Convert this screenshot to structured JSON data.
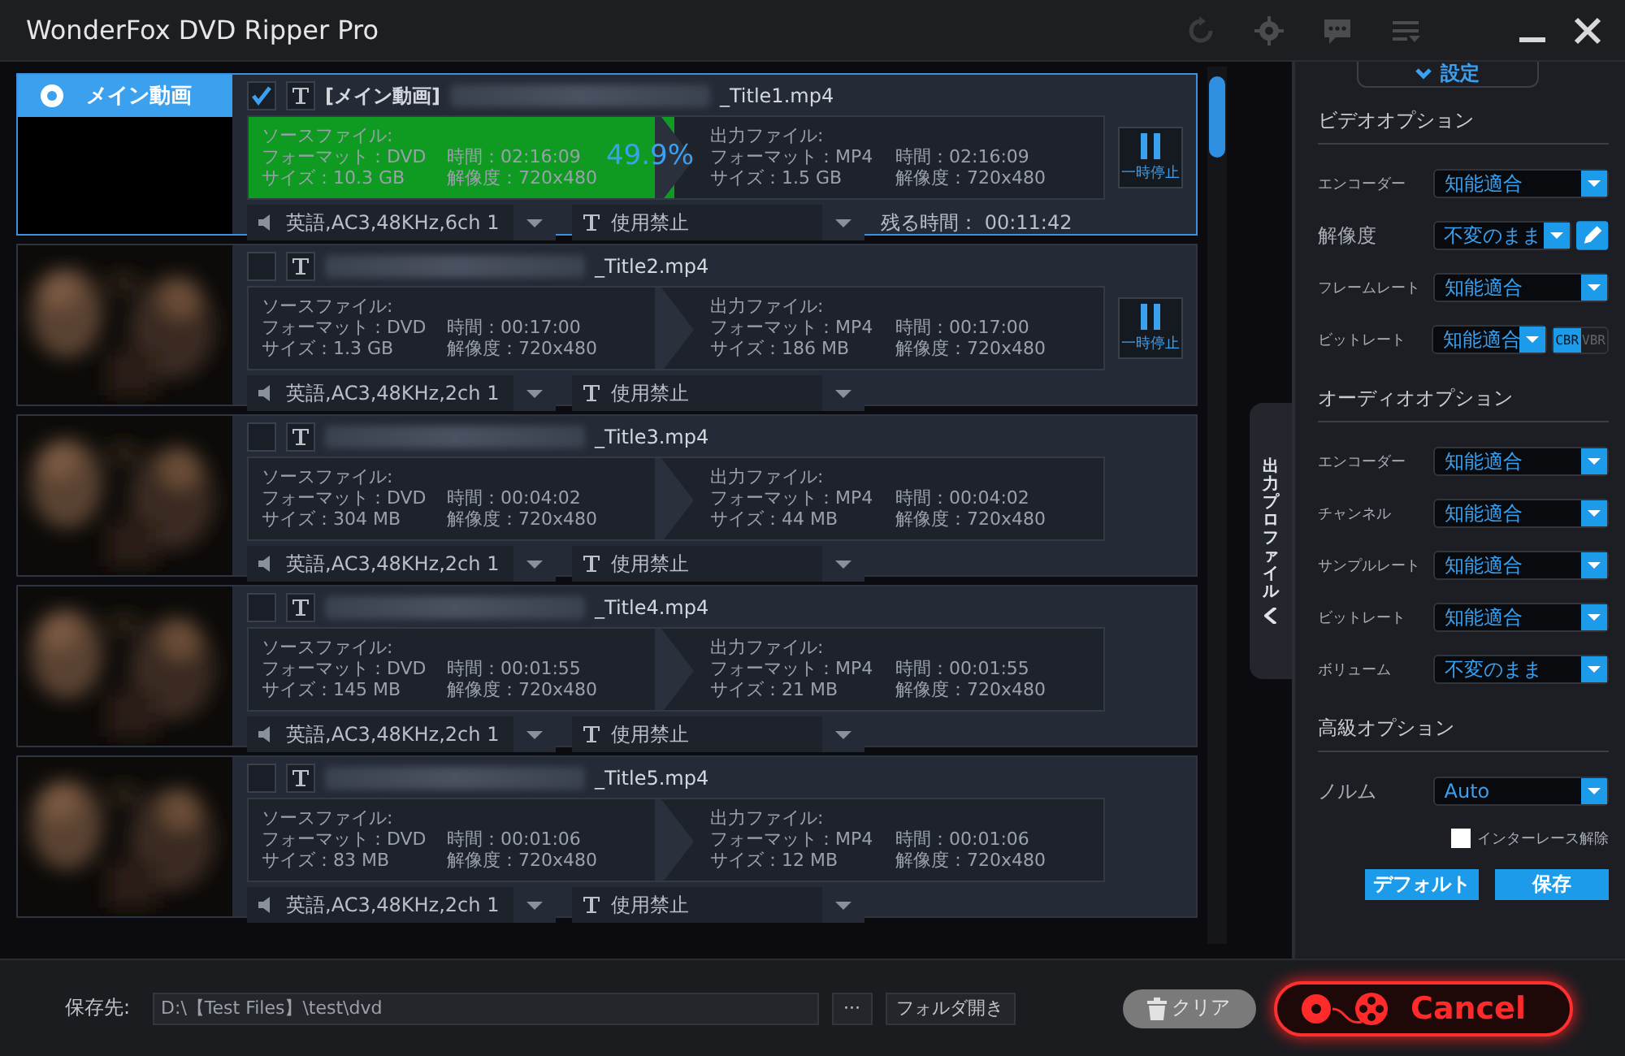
{
  "window": {
    "title": "WonderFox DVD Ripper Pro"
  },
  "titles": [
    {
      "thumbnail": {
        "kind": "main",
        "label": "メイン動画",
        "selected": true
      },
      "checked": true,
      "name_prefix": "[メイン動画]",
      "name_suffix": "_Title1.mp4",
      "source": {
        "label": "ソースファイル:",
        "format": "フォーマット：DVD",
        "duration": "時間：02:16:09",
        "size": "サイズ：10.3 GB",
        "resolution": "解像度：720x480"
      },
      "progress": {
        "level": 0.499,
        "percent": "49.9%"
      },
      "output": {
        "label": "出力ファイル:",
        "format": "フォーマット：MP4",
        "duration": "時間：02:16:09",
        "size": "サイズ：1.5 GB",
        "resolution": "解像度：720x480"
      },
      "pause": "一時停止",
      "audio": "英語,AC3,48KHz,6ch 1",
      "subtitle": "使用禁止",
      "remaining": "残る時間：  00:11:42",
      "active": true
    },
    {
      "checked": false,
      "name_suffix": "_Title2.mp4",
      "source": {
        "label": "ソースファイル:",
        "format": "フォーマット：DVD",
        "duration": "時間：00:17:00",
        "size": "サイズ：1.3 GB",
        "resolution": "解像度：720x480"
      },
      "output": {
        "label": "出力ファイル:",
        "format": "フォーマット：MP4",
        "duration": "時間：00:17:00",
        "size": "サイズ：186 MB",
        "resolution": "解像度：720x480"
      },
      "pause": "一時停止",
      "audio": "英語,AC3,48KHz,2ch 1",
      "subtitle": "使用禁止",
      "active": false
    },
    {
      "checked": false,
      "name_suffix": "_Title3.mp4",
      "source": {
        "label": "ソースファイル:",
        "format": "フォーマット：DVD",
        "duration": "時間：00:04:02",
        "size": "サイズ：304 MB",
        "resolution": "解像度：720x480"
      },
      "output": {
        "label": "出力ファイル:",
        "format": "フォーマット：MP4",
        "duration": "時間：00:04:02",
        "size": "サイズ：44 MB",
        "resolution": "解像度：720x480"
      },
      "audio": "英語,AC3,48KHz,2ch 1",
      "subtitle": "使用禁止",
      "active": false
    },
    {
      "checked": false,
      "name_suffix": "_Title4.mp4",
      "source": {
        "label": "ソースファイル:",
        "format": "フォーマット：DVD",
        "duration": "時間：00:01:55",
        "size": "サイズ：145 MB",
        "resolution": "解像度：720x480"
      },
      "output": {
        "label": "出力ファイル:",
        "format": "フォーマット：MP4",
        "duration": "時間：00:01:55",
        "size": "サイズ：21 MB",
        "resolution": "解像度：720x480"
      },
      "audio": "英語,AC3,48KHz,2ch 1",
      "subtitle": "使用禁止",
      "active": false
    },
    {
      "checked": false,
      "name_suffix": "_Title5.mp4",
      "source": {
        "label": "ソースファイル:",
        "format": "フォーマット：DVD",
        "duration": "時間：00:01:06",
        "size": "サイズ：83 MB",
        "resolution": "解像度：720x480"
      },
      "output": {
        "label": "出力ファイル:",
        "format": "フォーマット：MP4",
        "duration": "時間：00:01:06",
        "size": "サイズ：12 MB",
        "resolution": "解像度：720x480"
      },
      "audio": "英語,AC3,48KHz,2ch 1",
      "subtitle": "使用禁止",
      "active": false
    }
  ],
  "side_tab": {
    "label": "出力プロファイル"
  },
  "settings": {
    "header": "設定",
    "sections": [
      {
        "title": "ビデオオプション",
        "items": [
          {
            "kind": "select",
            "label": "エンコーダー",
            "value": "知能適合"
          },
          {
            "kind": "select_edit",
            "label": "解像度",
            "value": "不変のまま"
          },
          {
            "kind": "select",
            "label": "フレームレート",
            "value": "知能適合"
          },
          {
            "kind": "select_mode",
            "label": "ビットレート",
            "value": "知能適合",
            "modes": [
              {
                "label": "CBR",
                "selected": true
              },
              {
                "label": "VBR",
                "selected": false
              }
            ]
          }
        ]
      },
      {
        "title": "オーディオオプション",
        "items": [
          {
            "kind": "select",
            "label": "エンコーダー",
            "value": "知能適合"
          },
          {
            "kind": "select",
            "label": "チャンネル",
            "value": "知能適合"
          },
          {
            "kind": "select",
            "label": "サンプルレート",
            "value": "知能適合"
          },
          {
            "kind": "select",
            "label": "ビットレート",
            "value": "知能適合"
          },
          {
            "kind": "select",
            "label": "ボリューム",
            "value": "不変のまま"
          }
        ]
      },
      {
        "title": "高級オプション",
        "items": [
          {
            "kind": "select",
            "label": "ノルム",
            "value": "Auto"
          },
          {
            "kind": "checkbox",
            "label": "インターレース解除",
            "checked": false
          }
        ]
      }
    ],
    "buttons": [
      "デフォルト",
      "保存"
    ]
  },
  "footer": {
    "label": "保存先:",
    "path": "D:\\【Test Files】\\test\\dvd",
    "browse": "···",
    "open_folder": "フォルダ開き",
    "clear": "クリア",
    "cancel": "Cancel"
  }
}
